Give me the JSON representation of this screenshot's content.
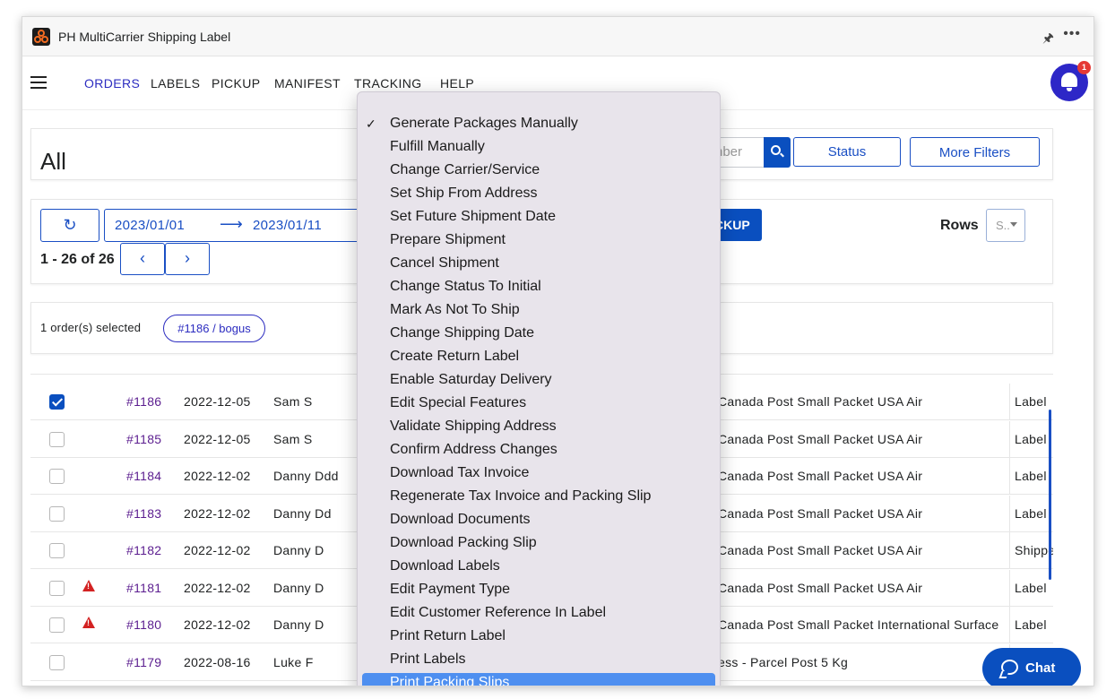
{
  "app": {
    "title": "PH MultiCarrier Shipping Label"
  },
  "nav": {
    "items": [
      "ORDERS",
      "LABELS",
      "PICKUP",
      "MANIFEST",
      "TRACKING",
      "HELP"
    ],
    "notification_count": "1"
  },
  "header": {
    "page_title": "All",
    "search_placeholder": "Order Number",
    "search_visible_text": "nber",
    "status_button": "Status",
    "more_filters_button": "More Filters"
  },
  "toolbar": {
    "date_from": "2023/01/01",
    "date_arrow": "⟶",
    "date_to": "2023/01/11",
    "pickup_partial": "CKUP",
    "rows_label": "Rows",
    "rows_value": "S..",
    "paging_text": "1 - 26 of 26",
    "prev": "‹",
    "next": "›"
  },
  "selection": {
    "text": "1 order(s) selected",
    "chip": "#1186 / bogus"
  },
  "table": {
    "rows": [
      {
        "order": "#1186",
        "date": "2022-12-05",
        "name": "Sam S",
        "service": "Canada Post Small Packet USA Air",
        "status": "Label",
        "checked": true,
        "warning": false
      },
      {
        "order": "#1185",
        "date": "2022-12-05",
        "name": "Sam S",
        "service": "Canada Post Small Packet USA Air",
        "status": "Label",
        "checked": false,
        "warning": false
      },
      {
        "order": "#1184",
        "date": "2022-12-02",
        "name": "Danny Ddd",
        "service": "Canada Post Small Packet USA Air",
        "status": "Label",
        "checked": false,
        "warning": false
      },
      {
        "order": "#1183",
        "date": "2022-12-02",
        "name": "Danny Dd",
        "service": "Canada Post Small Packet USA Air",
        "status": "Label",
        "checked": false,
        "warning": false
      },
      {
        "order": "#1182",
        "date": "2022-12-02",
        "name": "Danny D",
        "service": "Canada Post Small Packet USA Air",
        "status": "Shippe",
        "checked": false,
        "warning": false
      },
      {
        "order": "#1181",
        "date": "2022-12-02",
        "name": "Danny D",
        "service": "Canada Post Small Packet USA Air",
        "status": "Label",
        "checked": false,
        "warning": true
      },
      {
        "order": "#1180",
        "date": "2022-12-02",
        "name": "Danny D",
        "service": "Canada Post Small Packet International Surface",
        "status": "Label",
        "checked": false,
        "warning": true
      },
      {
        "order": "#1179",
        "date": "2022-08-16",
        "name": "Luke F",
        "service": "ess - Parcel Post 5 Kg",
        "status": "",
        "checked": false,
        "warning": false
      }
    ]
  },
  "menu": {
    "checked_index": 0,
    "highlighted_index": 24,
    "check_glyph": "✓",
    "items": [
      "Generate Packages Manually",
      "Fulfill Manually",
      "Change Carrier/Service",
      "Set Ship From Address",
      "Set Future Shipment Date",
      "Prepare Shipment",
      "Cancel Shipment",
      "Change Status To Initial",
      "Mark As Not To Ship",
      "Change Shipping Date",
      "Create Return Label",
      "Enable Saturday Delivery",
      "Edit Special Features",
      "Validate Shipping Address",
      "Confirm Address Changes",
      "Download Tax Invoice",
      "Regenerate Tax Invoice and Packing Slip",
      "Download Documents",
      "Download Packing Slip",
      "Download Labels",
      "Edit Payment Type",
      "Edit Customer Reference In Label",
      "Print Return Label",
      "Print Labels",
      "Print Packing Slips"
    ]
  },
  "chat": {
    "label": "Chat"
  },
  "icons": {
    "pin": "pin-icon",
    "more": "more-horizontal-icon",
    "bell": "bell-icon",
    "search": "search-icon",
    "refresh": "refresh-icon",
    "chat": "chat-bubble-icon"
  },
  "colors": {
    "accent": "#1a4fc4",
    "primary_fill": "#0a4fbf",
    "nav_active": "#2c2cc0",
    "order_link": "#5b1d8f",
    "warning": "#d32222",
    "menu_bg": "#e8e4eb",
    "menu_highlight": "#4e8ff0"
  }
}
